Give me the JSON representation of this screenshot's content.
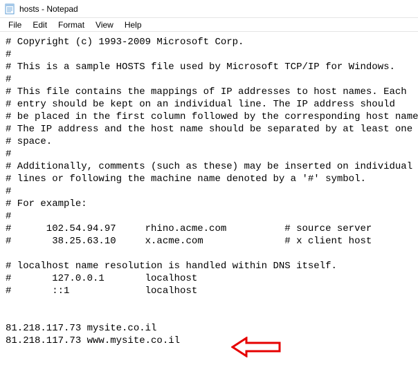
{
  "window": {
    "title": "hosts - Notepad"
  },
  "menu": {
    "file": "File",
    "edit": "Edit",
    "format": "Format",
    "view": "View",
    "help": "Help"
  },
  "content": {
    "lines": [
      "# Copyright (c) 1993-2009 Microsoft Corp.",
      "#",
      "# This is a sample HOSTS file used by Microsoft TCP/IP for Windows.",
      "#",
      "# This file contains the mappings of IP addresses to host names. Each",
      "# entry should be kept on an individual line. The IP address should",
      "# be placed in the first column followed by the corresponding host name.",
      "# The IP address and the host name should be separated by at least one",
      "# space.",
      "#",
      "# Additionally, comments (such as these) may be inserted on individual",
      "# lines or following the machine name denoted by a '#' symbol.",
      "#",
      "# For example:",
      "#",
      "#      102.54.94.97     rhino.acme.com          # source server",
      "#       38.25.63.10     x.acme.com              # x client host",
      "",
      "# localhost name resolution is handled within DNS itself.",
      "#       127.0.0.1       localhost",
      "#       ::1             localhost",
      "",
      "",
      "81.218.117.73 mysite.co.il",
      "81.218.117.73 www.mysite.co.il"
    ]
  },
  "arrow_color": "#e60000"
}
